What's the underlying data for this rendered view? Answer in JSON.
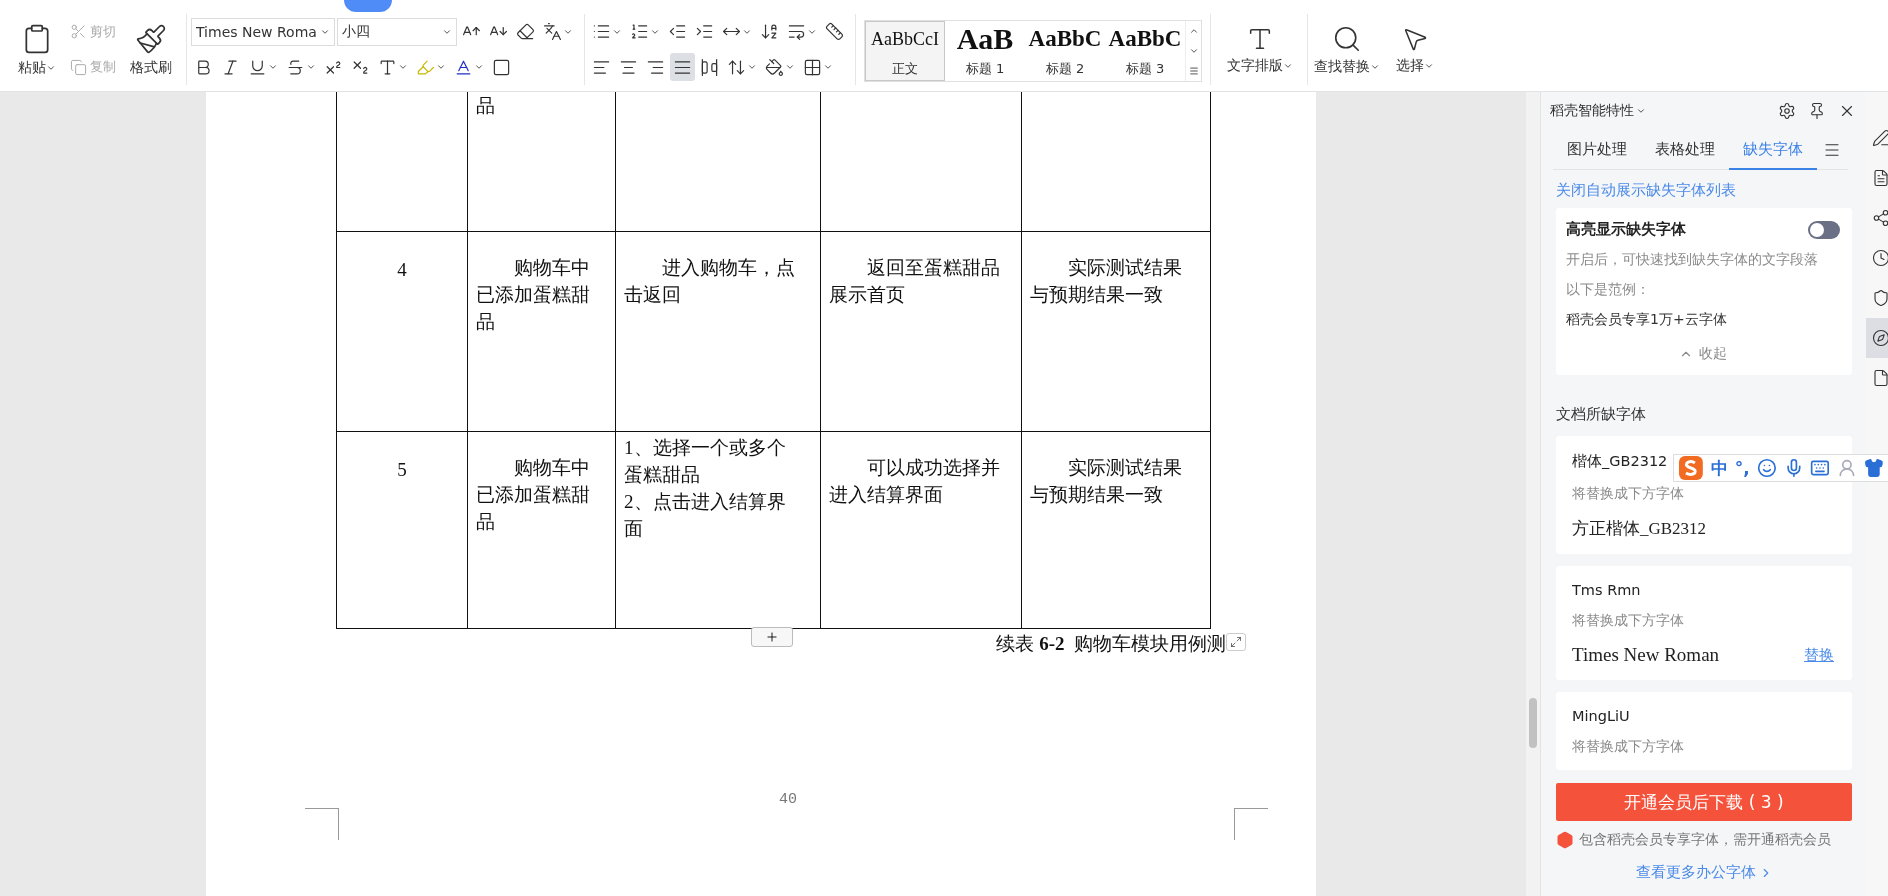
{
  "toolbar": {
    "paste": {
      "label": "粘贴"
    },
    "cut": {
      "label": "剪切",
      "disabled": true
    },
    "copy": {
      "label": "复制",
      "disabled": true
    },
    "format_painter": {
      "label": "格式刷"
    },
    "font_name": {
      "value": "Times New Roma"
    },
    "font_size": {
      "value": "小四"
    },
    "alignment": [
      {
        "selected": false
      },
      {
        "selected": false
      },
      {
        "selected": false
      },
      {
        "selected": true
      },
      {
        "selected": false
      }
    ],
    "styles": [
      {
        "preview": "AaBbCcI",
        "label": "正文",
        "selected": true
      },
      {
        "preview": "AaB",
        "label": "标题 1",
        "selected": false
      },
      {
        "preview": "AaBbC",
        "label": "标题 2",
        "selected": false
      },
      {
        "preview": "AaBbC",
        "label": "标题 3",
        "selected": false
      }
    ],
    "layout_button": {
      "label": "文字排版"
    },
    "find_button": {
      "label": "查找替换"
    },
    "select_button": {
      "label": "选择"
    }
  },
  "document": {
    "table": {
      "rows": [
        {
          "cells": [
            {
              "kind": "empty"
            },
            {
              "kind": "plain",
              "paragraphs": [
                "品"
              ]
            },
            {
              "kind": "empty"
            },
            {
              "kind": "empty"
            },
            {
              "kind": "empty"
            }
          ]
        },
        {
          "cells": [
            {
              "kind": "number",
              "paragraphs": [
                "4"
              ]
            },
            {
              "kind": "indented",
              "paragraphs": [
                "购物车中已添加蛋糕甜品"
              ]
            },
            {
              "kind": "indented",
              "paragraphs": [
                "进入购物车，点击返回"
              ]
            },
            {
              "kind": "indented",
              "paragraphs": [
                "返回至蛋糕甜品展示首页"
              ]
            },
            {
              "kind": "indented",
              "paragraphs": [
                "实际测试结果与预期结果一致"
              ]
            }
          ]
        },
        {
          "cells": [
            {
              "kind": "number",
              "paragraphs": [
                "5"
              ]
            },
            {
              "kind": "indented",
              "paragraphs": [
                "购物车中已添加蛋糕甜品"
              ]
            },
            {
              "kind": "list",
              "paragraphs": [
                "1、选择一个或多个蛋糕甜品",
                "2、点击进入结算界面"
              ]
            },
            {
              "kind": "indented",
              "paragraphs": [
                "可以成功选择并进入结算界面"
              ]
            },
            {
              "kind": "indented",
              "paragraphs": [
                "实际测试结果与预期结果一致"
              ]
            }
          ]
        }
      ]
    },
    "caption": "续表 **6-2**  购物车模块用例测",
    "page_number": "40"
  },
  "panel": {
    "title": "稻壳智能特性",
    "tabs": [
      {
        "label": "图片处理",
        "selected": false
      },
      {
        "label": "表格处理",
        "selected": false
      },
      {
        "label": "缺失字体",
        "selected": true
      }
    ],
    "close_link": "关闭自动展示缺失字体列表",
    "highlight_card": {
      "title": "高亮显示缺失字体",
      "on": false,
      "description": "开启后，可快速找到缺失字体的文字段落",
      "example_label": "以下是范例：",
      "example": "稻壳会员专享1万+云字体",
      "collapse": "收起"
    },
    "section_title": "文档所缺字体",
    "fonts": [
      {
        "missing": "楷体_GB2312",
        "hint": "将替换成下方字体",
        "replacement": "方正楷体_GB2312"
      },
      {
        "missing": "Tms Rmn",
        "hint": "将替换成下方字体",
        "replacement": "Times New Roman",
        "action": "替换"
      },
      {
        "missing": "MingLiU",
        "hint": "将替换成下方字体"
      }
    ],
    "download_button": "开通会员后下载 ( 3 )",
    "note": "包含稻壳会员专享字体，需开通稻壳会员",
    "more_link": "查看更多办公字体"
  },
  "ime_bar": {
    "mode": "中",
    "punctuation": "°,"
  }
}
